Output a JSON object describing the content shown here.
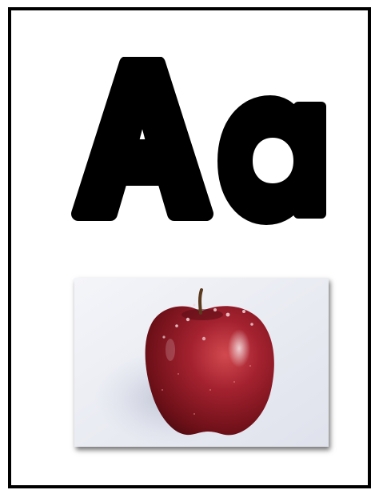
{
  "flashcard": {
    "letter_pair": "Aa",
    "uppercase": "A",
    "lowercase": "a",
    "picture": "apple",
    "colors": {
      "border": "#000000",
      "letters": "#000000",
      "apple": "#9c1f2a",
      "background": "#ffffff"
    }
  }
}
